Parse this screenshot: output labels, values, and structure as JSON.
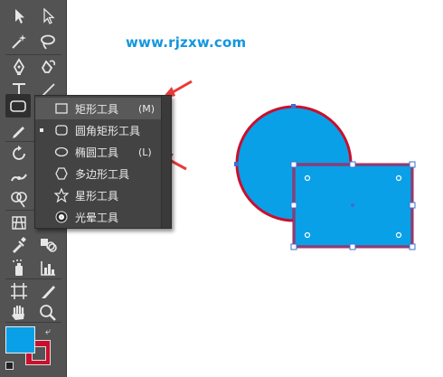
{
  "watermark": {
    "text": "www.rjzxw.com"
  },
  "colors": {
    "accent_fill": "#0aa0e8",
    "shape_stroke": "#c8102e",
    "selection": "#3b6fd6",
    "panel_bg": "#535353",
    "arrow": "#e83a3a"
  },
  "toolbar": {
    "tools": [
      {
        "name": "selection-tool",
        "icon": "arrow-icon"
      },
      {
        "name": "direct-selection-tool",
        "icon": "white-arrow-icon"
      },
      {
        "name": "magic-wand-tool",
        "icon": "magic-wand-icon"
      },
      {
        "name": "lasso-tool",
        "icon": "lasso-icon"
      },
      {
        "name": "pen-tool",
        "icon": "pen-icon"
      },
      {
        "name": "curvature-tool",
        "icon": "curvature-pen-icon"
      },
      {
        "name": "type-tool",
        "icon": "type-icon"
      },
      {
        "name": "line-tool",
        "icon": "line-icon"
      },
      {
        "name": "rectangle-tool",
        "icon": "rounded-rect-icon"
      },
      {
        "name": "pencil-tool",
        "icon": "pencil-icon"
      },
      {
        "name": "rotate-tool",
        "icon": "rotate-icon"
      },
      {
        "name": "width-tool",
        "icon": "width-icon"
      },
      {
        "name": "shape-builder-tool",
        "icon": "shape-builder-icon"
      },
      {
        "name": "perspective-grid-tool",
        "icon": "perspective-icon"
      },
      {
        "name": "eyedropper-tool",
        "icon": "eyedropper-icon"
      },
      {
        "name": "blend-tool",
        "icon": "blend-icon"
      },
      {
        "name": "symbol-sprayer-tool",
        "icon": "spray-icon"
      },
      {
        "name": "column-graph-tool",
        "icon": "graph-icon"
      },
      {
        "name": "artboard-tool",
        "icon": "artboard-icon"
      },
      {
        "name": "slice-tool",
        "icon": "slice-icon"
      },
      {
        "name": "hand-tool",
        "icon": "hand-icon"
      },
      {
        "name": "zoom-tool",
        "icon": "zoom-icon"
      }
    ],
    "fill_color": "#0aa0e8",
    "stroke_color": "#c8102e"
  },
  "flyout": {
    "items": [
      {
        "label": "矩形工具",
        "shortcut": "(M)",
        "icon": "rectangle-icon",
        "active": false,
        "highlighted": true
      },
      {
        "label": "圆角矩形工具",
        "shortcut": "",
        "icon": "rounded-rectangle-icon",
        "active": true,
        "highlighted": false
      },
      {
        "label": "椭圆工具",
        "shortcut": "(L)",
        "icon": "ellipse-icon",
        "active": false,
        "highlighted": false
      },
      {
        "label": "多边形工具",
        "shortcut": "",
        "icon": "polygon-icon",
        "active": false,
        "highlighted": false
      },
      {
        "label": "星形工具",
        "shortcut": "",
        "icon": "star-icon",
        "active": false,
        "highlighted": false
      },
      {
        "label": "光晕工具",
        "shortcut": "",
        "icon": "flare-icon",
        "active": false,
        "highlighted": false
      }
    ]
  }
}
